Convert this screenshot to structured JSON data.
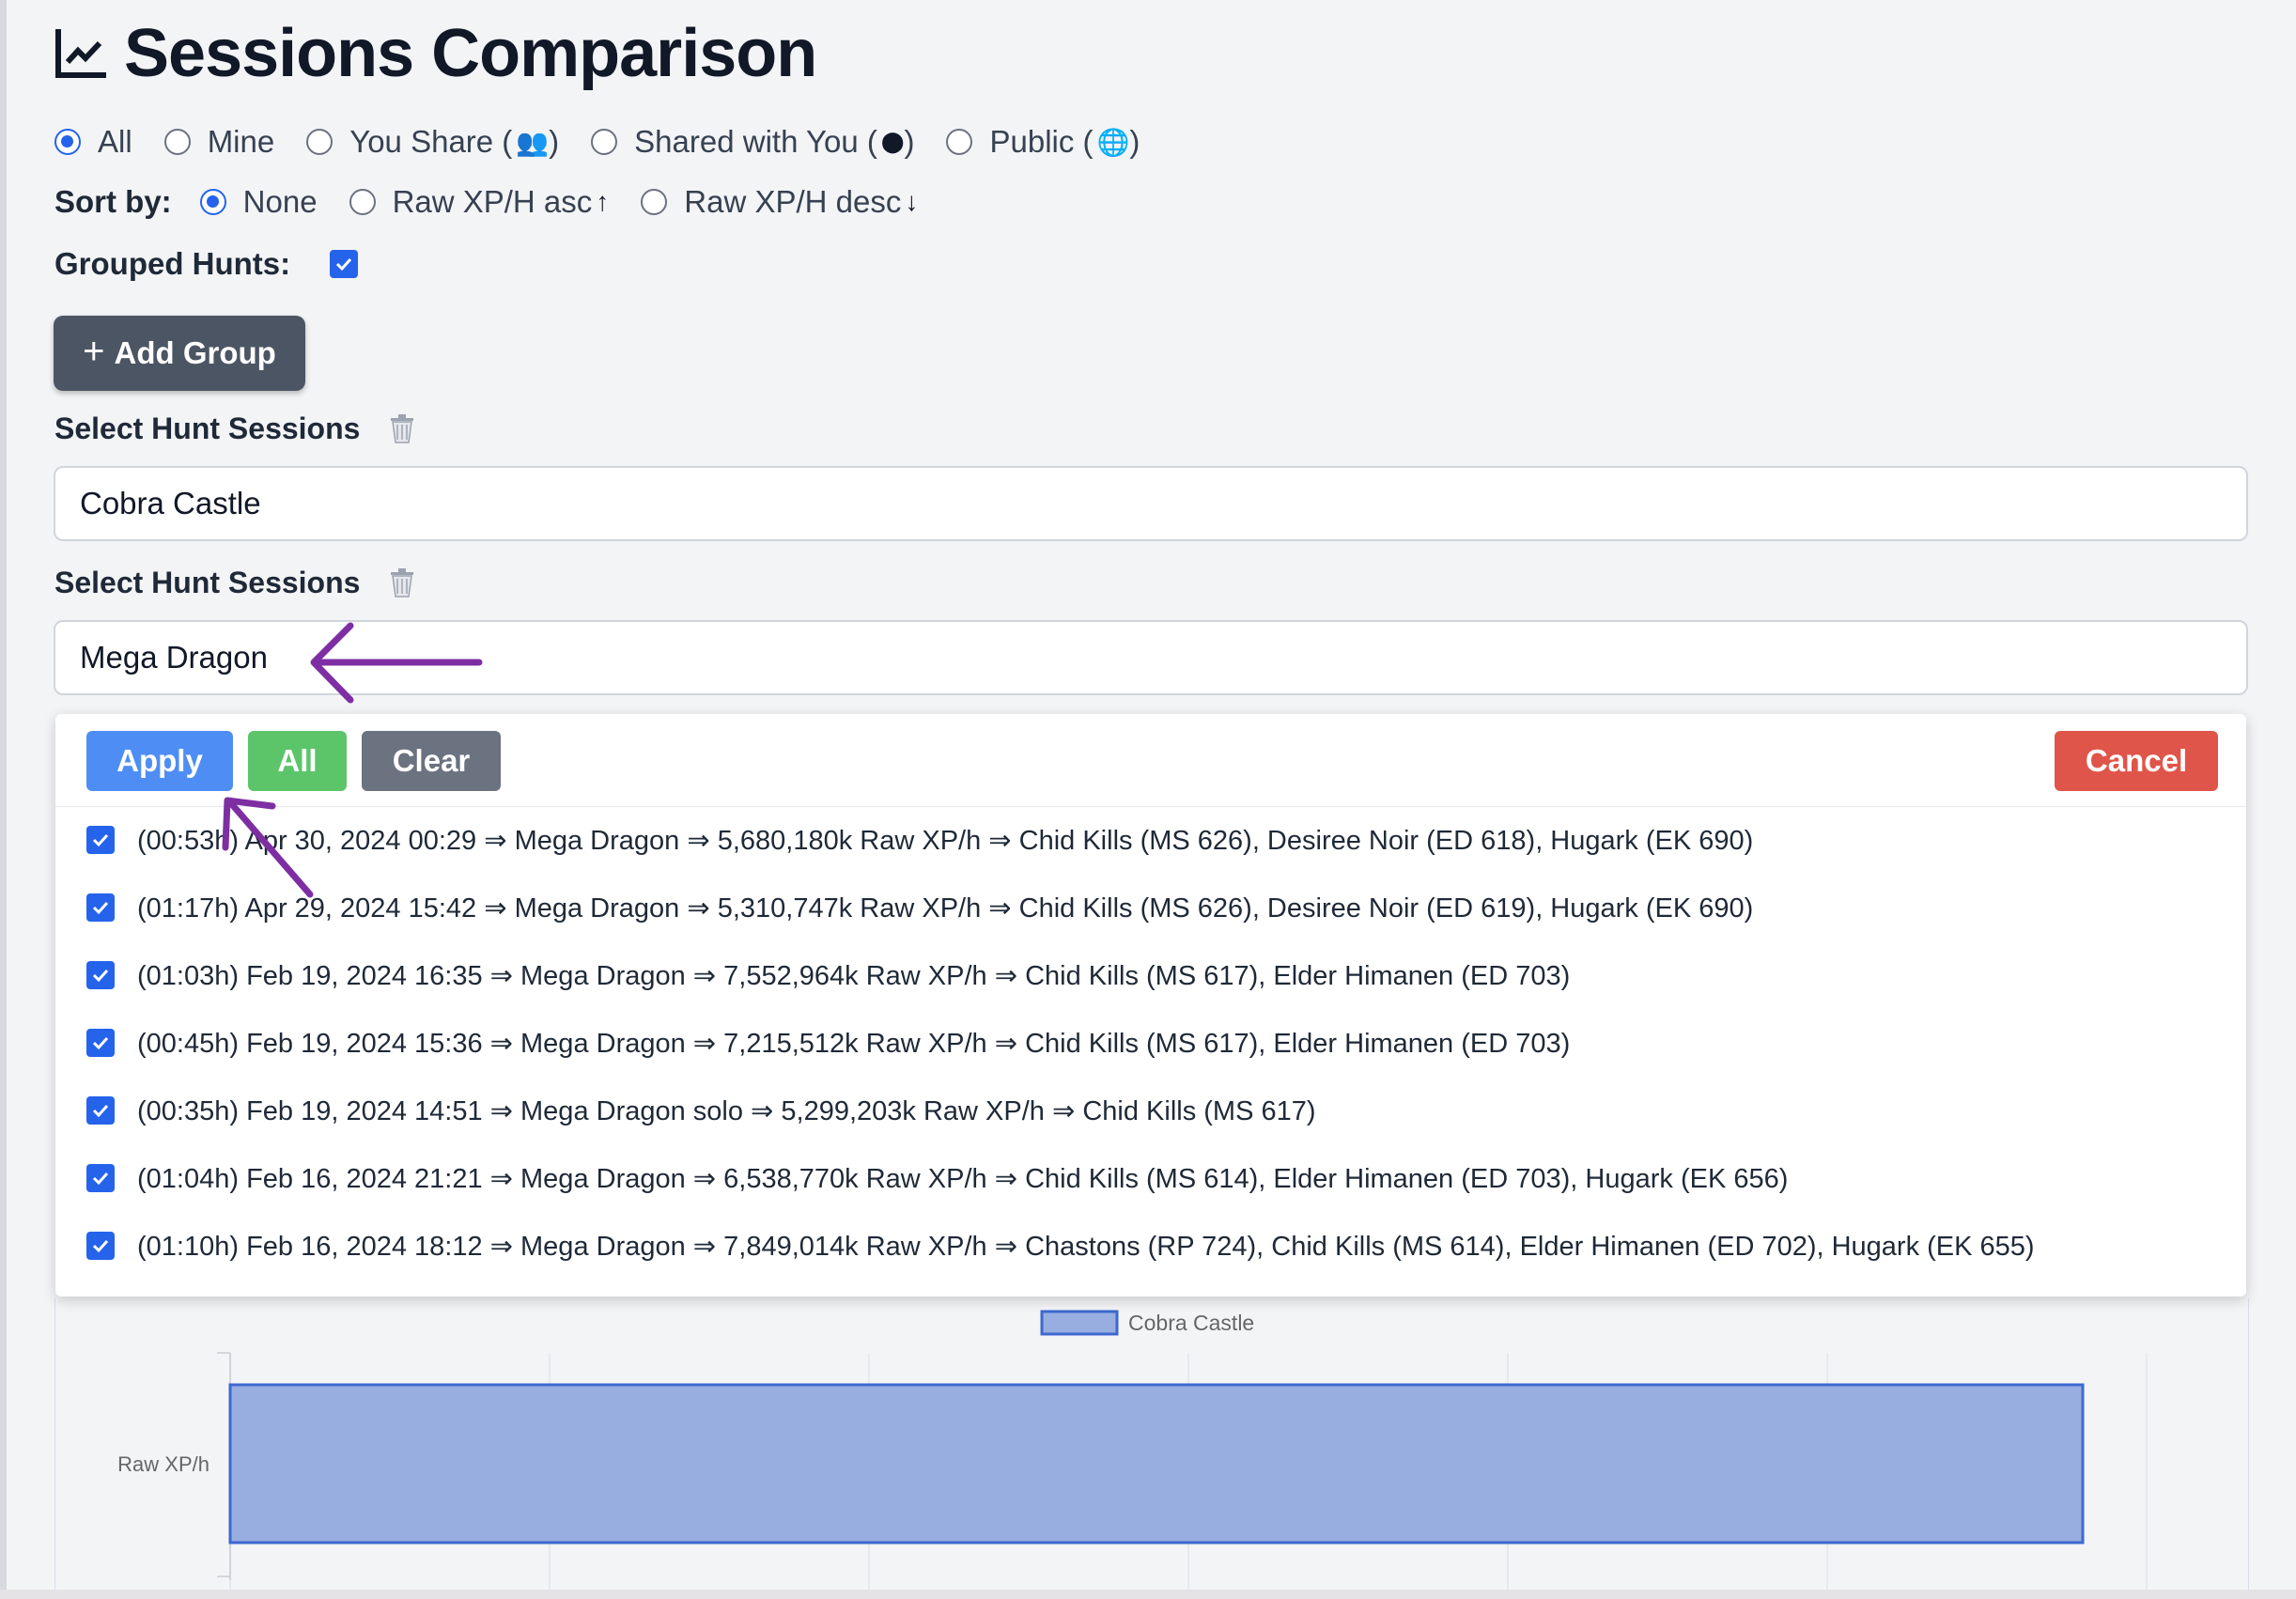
{
  "page": {
    "title": "Sessions Comparison"
  },
  "icons": {
    "title": "chart-line-icon",
    "you_share": "users-icon",
    "shared_with_you": "filled-circle-icon",
    "public": "globe-icon",
    "trash": "trash-icon",
    "sort_asc": "arrow-up-icon",
    "sort_desc": "arrow-down-icon"
  },
  "filter": {
    "selected": "All",
    "options": [
      {
        "label": "All",
        "glyph": ""
      },
      {
        "label": "Mine",
        "glyph": ""
      },
      {
        "label": "You Share (",
        "glyph": "👥",
        "suffix": ")"
      },
      {
        "label": "Shared with You (",
        "glyph": "⬤",
        "suffix": ")"
      },
      {
        "label": "Public (",
        "glyph": "🌐",
        "suffix": ")"
      }
    ]
  },
  "sort": {
    "label": "Sort by:",
    "selected": "None",
    "options": [
      {
        "label": "None",
        "glyph": ""
      },
      {
        "label": "Raw XP/H asc",
        "glyph": "↑"
      },
      {
        "label": "Raw XP/H desc",
        "glyph": "↓"
      }
    ]
  },
  "grouped_hunts": {
    "label": "Grouped Hunts:",
    "checked": true
  },
  "add_group": {
    "label": "Add Group",
    "plus": "+"
  },
  "groups": [
    {
      "label": "Select Hunt Sessions",
      "value": "Cobra Castle"
    },
    {
      "label": "Select Hunt Sessions",
      "value": "Mega Dragon"
    }
  ],
  "dropdown": {
    "apply_label": "Apply",
    "all_label": "All",
    "clear_label": "Clear",
    "cancel_label": "Cancel",
    "sessions": [
      "(00:53h) Apr 30, 2024 00:29 ⇒ Mega Dragon ⇒ 5,680,180k Raw XP/h ⇒ Chid Kills (MS 626), Desiree Noir (ED 618), Hugark (EK 690)",
      "(01:17h) Apr 29, 2024 15:42 ⇒ Mega Dragon ⇒ 5,310,747k Raw XP/h ⇒ Chid Kills (MS 626), Desiree Noir (ED 619), Hugark (EK 690)",
      "(01:03h) Feb 19, 2024 16:35 ⇒ Mega Dragon ⇒ 7,552,964k Raw XP/h ⇒ Chid Kills (MS 617), Elder Himanen (ED 703)",
      "(00:45h) Feb 19, 2024 15:36 ⇒ Mega Dragon ⇒ 7,215,512k Raw XP/h ⇒ Chid Kills (MS 617), Elder Himanen (ED 703)",
      "(00:35h) Feb 19, 2024 14:51 ⇒ Mega Dragon solo ⇒ 5,299,203k Raw XP/h ⇒ Chid Kills (MS 617)",
      "(01:04h) Feb 16, 2024 21:21 ⇒ Mega Dragon ⇒ 6,538,770k Raw XP/h ⇒ Chid Kills (MS 614), Elder Himanen (ED 703), Hugark (EK 656)",
      "(01:10h) Feb 16, 2024 18:12 ⇒ Mega Dragon ⇒ 7,849,014k Raw XP/h ⇒ Chastons (RP 724), Chid Kills (MS 614), Elder Himanen (ED 702), Hugark (EK 655)"
    ]
  },
  "colors": {
    "accent": "#2563eb",
    "apply": "#4e8ef4",
    "all": "#5cc56a",
    "clear": "#6b7280",
    "cancel": "#e05549",
    "bar_fill": "#99aee0",
    "bar_stroke": "#3d68d0",
    "annotation": "#7e2ea3"
  },
  "chart_data": {
    "type": "bar",
    "orientation": "horizontal",
    "categories": [
      "Raw XP/h"
    ],
    "series": [
      {
        "name": "Cobra Castle",
        "values": [
          5.8
        ]
      }
    ],
    "xlim": [
      0,
      6
    ],
    "legend": "top-center",
    "grid": true,
    "note": "value axis partially hidden; visible bar ends near 5.8 of 6 gridline units"
  }
}
